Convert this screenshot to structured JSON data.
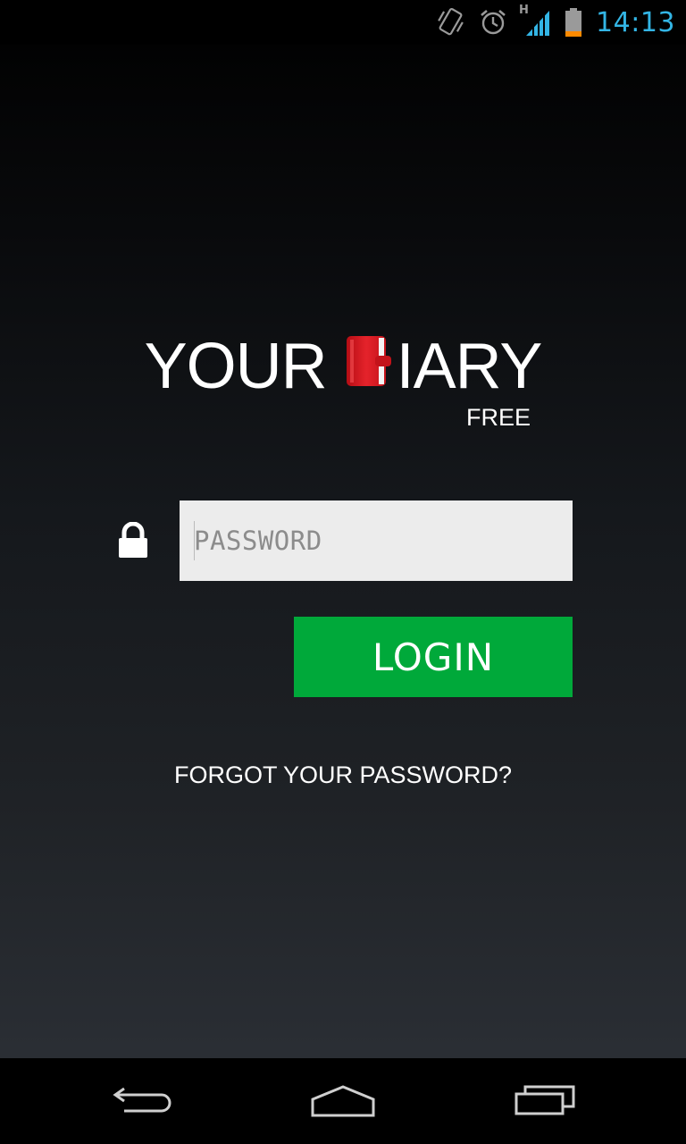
{
  "status_bar": {
    "time": "14:13",
    "network_type": "H",
    "icons": [
      "vibrate-icon",
      "alarm-icon",
      "signal-icon",
      "battery-icon"
    ],
    "time_color": "#33b5e5"
  },
  "logo": {
    "text_left": "YOUR",
    "text_right": "IARY",
    "icon": "diary-book-icon",
    "icon_color": "#e01e26",
    "subtitle": "FREE"
  },
  "login_form": {
    "lock_icon": "lock-icon",
    "password_placeholder": "PASSWORD",
    "password_value": "",
    "login_label": "LOGIN",
    "login_color": "#00a93a",
    "forgot_label": "FORGOT YOUR PASSWORD?"
  },
  "nav_bar": {
    "buttons": [
      "back-icon",
      "home-icon",
      "recent-apps-icon"
    ]
  }
}
